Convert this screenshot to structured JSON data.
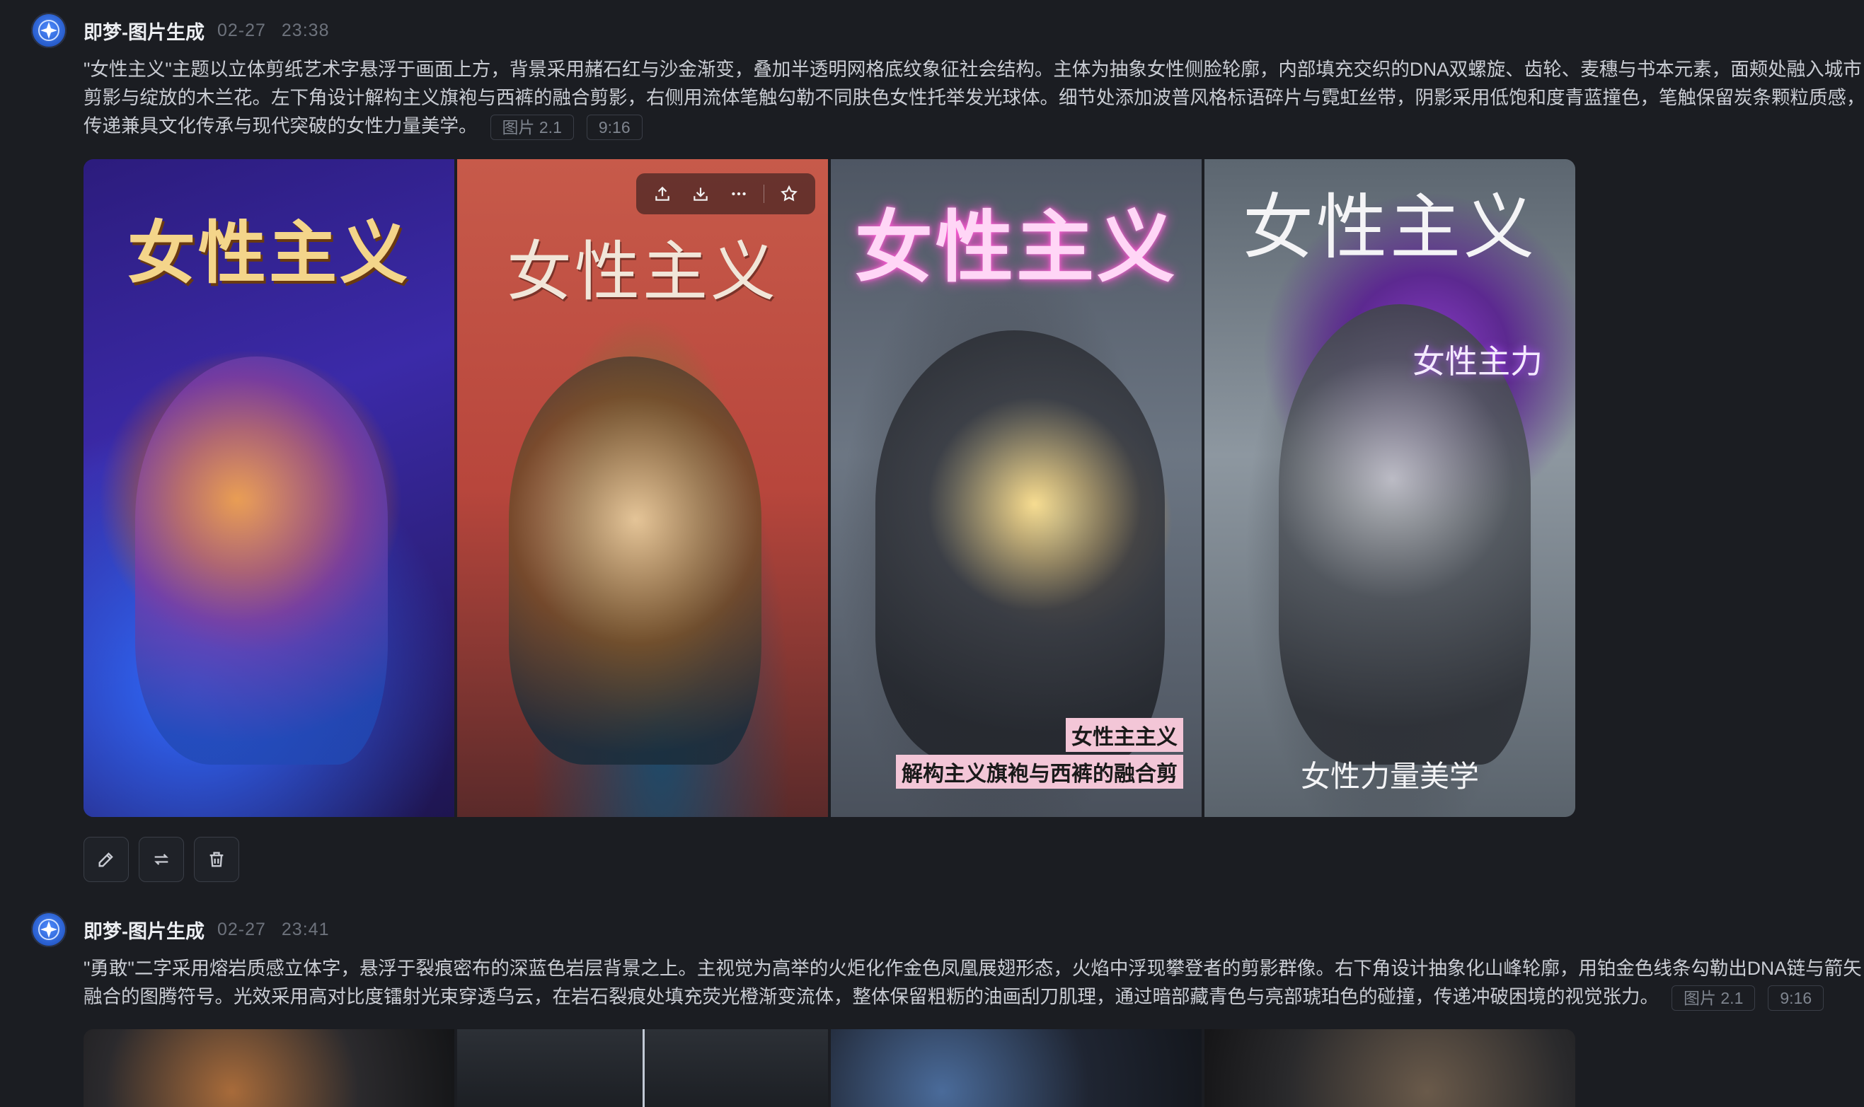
{
  "entries": [
    {
      "author": "即梦-图片生成",
      "date": "02-27",
      "time": "23:38",
      "prompt": "\"女性主义\"主题以立体剪纸艺术字悬浮于画面上方，背景采用赭石红与沙金渐变，叠加半透明网格底纹象征社会结构。主体为抽象女性侧脸轮廓，内部填充交织的DNA双螺旋、齿轮、麦穗与书本元素，面颊处融入城市剪影与绽放的木兰花。左下角设计解构主义旗袍与西裤的融合剪影，右侧用流体笔触勾勒不同肤色女性托举发光球体。细节处添加波普风格标语碎片与霓虹丝带，阴影采用低饱和度青蓝撞色，笔触保留炭条颗粒质感，传递兼具文化传承与现代突破的女性力量美学。",
      "model_chip": "图片 2.1",
      "ratio_chip": "9:16",
      "images": [
        {
          "title": "女性主义"
        },
        {
          "title": "女性主义"
        },
        {
          "title": "女性主义",
          "caption_line1": "女性主主义",
          "caption_line2": "解构主义旗袍与西裤的融合剪"
        },
        {
          "title": "女性主义",
          "badge": "女性主力",
          "caption": "女性力量美学"
        }
      ],
      "actions": [
        "edit-icon",
        "regenerate-icon",
        "delete-icon"
      ],
      "hover_toolbar": [
        "share-icon",
        "download-icon",
        "more-icon",
        "star-icon"
      ]
    },
    {
      "author": "即梦-图片生成",
      "date": "02-27",
      "time": "23:41",
      "prompt": "\"勇敢\"二字采用熔岩质感立体字，悬浮于裂痕密布的深蓝色岩层背景之上。主视觉为高举的火炬化作金色凤凰展翅形态，火焰中浮现攀登者的剪影群像。右下角设计抽象化山峰轮廓，用铂金色线条勾勒出DNA链与箭矢融合的图腾符号。光效采用高对比度镭射光束穿透乌云，在岩石裂痕处填充荧光橙渐变流体，整体保留粗粝的油画刮刀肌理，通过暗部藏青色与亮部琥珀色的碰撞，传递冲破困境的视觉张力。",
      "model_chip": "图片 2.1",
      "ratio_chip": "9:16"
    }
  ],
  "colors": {
    "background": "#1b1d22",
    "accent": "#2458c7",
    "muted_text": "#6d727c"
  }
}
